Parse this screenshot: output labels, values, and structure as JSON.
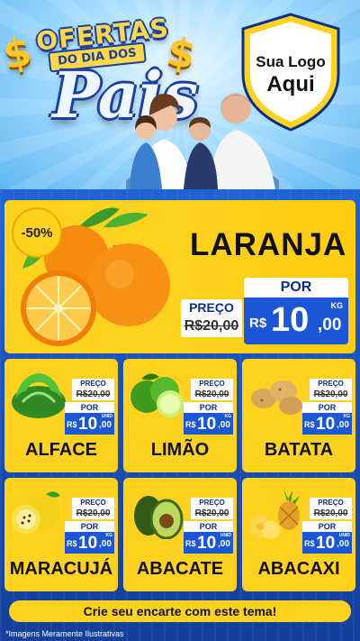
{
  "header": {
    "title_top": "OFERTAS",
    "title_mid": "DO DIA DOS",
    "title_main": "Pais",
    "logo_line1": "Sua Logo",
    "logo_line2": "Aqui"
  },
  "featured": {
    "discount": "-50%",
    "name": "LARANJA",
    "preco_label": "PREÇO",
    "old_price": "R$20,00",
    "por_label": "POR",
    "currency": "R$",
    "price_int": "10",
    "price_dec": ",00",
    "unit": "KG"
  },
  "products": [
    {
      "name": "ALFACE",
      "preco_label": "PREÇO",
      "old_price": "R$20,00",
      "por_label": "POR",
      "currency": "R$",
      "price_int": "10",
      "price_dec": ",00",
      "unit": "UNID"
    },
    {
      "name": "LIMÃO",
      "preco_label": "PREÇO",
      "old_price": "R$20,00",
      "por_label": "POR",
      "currency": "R$",
      "price_int": "10",
      "price_dec": ",00",
      "unit": "KG"
    },
    {
      "name": "BATATA",
      "preco_label": "PREÇO",
      "old_price": "R$20,00",
      "por_label": "POR",
      "currency": "R$",
      "price_int": "10",
      "price_dec": ",00",
      "unit": "KG"
    },
    {
      "name": "MARACUJÁ",
      "preco_label": "PREÇO",
      "old_price": "R$20,00",
      "por_label": "POR",
      "currency": "R$",
      "price_int": "10",
      "price_dec": ",00",
      "unit": "KG"
    },
    {
      "name": "ABACATE",
      "preco_label": "PREÇO",
      "old_price": "R$20,00",
      "por_label": "POR",
      "currency": "R$",
      "price_int": "10",
      "price_dec": ",00",
      "unit": "UNID"
    },
    {
      "name": "ABACAXI",
      "preco_label": "PREÇO",
      "old_price": "R$20,00",
      "por_label": "POR",
      "currency": "R$",
      "price_int": "10",
      "price_dec": ",00",
      "unit": "UNID"
    }
  ],
  "cta": "Crie seu encarte com este tema!",
  "note": "*Imagens Meramente Ilustrativas",
  "colors": {
    "accent_yellow": "#ffd21f",
    "brand_blue": "#1a56d6",
    "background_blue": "#1565c0"
  }
}
